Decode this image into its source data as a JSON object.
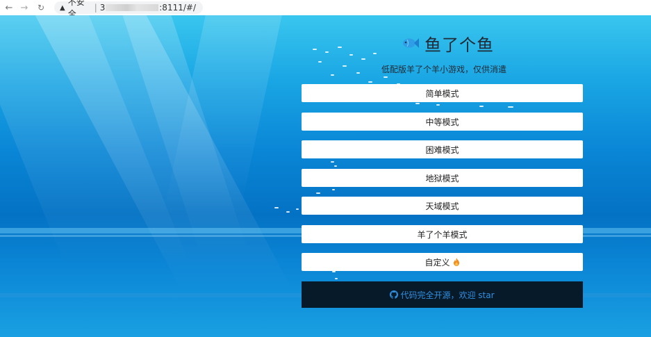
{
  "browser": {
    "back_icon": "back-arrow-icon",
    "forward_icon": "forward-arrow-icon",
    "reload_icon": "reload-icon",
    "warning_icon": "warning-triangle-icon",
    "insecure_label": "不安全",
    "separator": "|",
    "url_start": "3",
    "url_end": ":8111/#/"
  },
  "game": {
    "title": "鱼了个鱼",
    "title_icon": "fish-icon",
    "subtitle": "低配版羊了个羊小游戏，仅供消遣",
    "modes": [
      {
        "label": "简单模式"
      },
      {
        "label": "中等模式"
      },
      {
        "label": "困难模式"
      },
      {
        "label": "地狱模式"
      },
      {
        "label": "天域模式"
      },
      {
        "label": "羊了个羊模式"
      },
      {
        "label": "自定义",
        "icon": "fire-icon"
      }
    ],
    "source_link": {
      "icon": "github-icon",
      "label": "代码完全开源，欢迎 star",
      "color": "#2f8fe0"
    }
  },
  "colors": {
    "water_top": "#39c6ee",
    "water_mid": "#0472c4",
    "source_bg": "#071a2a"
  }
}
